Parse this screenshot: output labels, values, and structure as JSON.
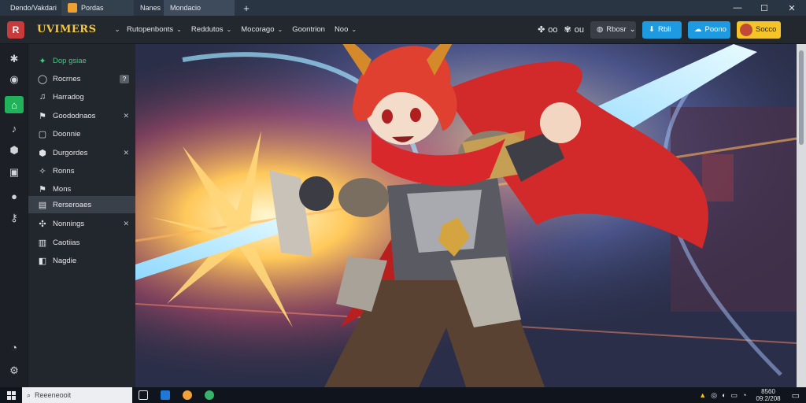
{
  "browser": {
    "tabs": [
      {
        "label": "Dendo/Vakdari",
        "color": "#27ae60"
      },
      {
        "label": "Pordas",
        "color": "#f0a030"
      },
      {
        "label": "Nanes",
        "color": ""
      },
      {
        "label": "Mondacio",
        "color": ""
      }
    ],
    "new_tab": "+",
    "window_controls": {
      "minimize": "—",
      "maximize": "☐",
      "close": "✕"
    }
  },
  "header": {
    "logo_letter": "R",
    "brand": "UVIMERS",
    "nav": [
      {
        "label": "Rutopenbonts"
      },
      {
        "label": "Reddutos"
      },
      {
        "label": "Mocorago"
      },
      {
        "label": "Goontrion"
      },
      {
        "label": "Noo"
      }
    ],
    "tools": {
      "icon1_label": "oo",
      "icon2_label": "ou",
      "gray_button": "Rbosr",
      "blue_button_1": "Rbli",
      "blue_button_2": "Poono",
      "yellow_button": "Socco"
    }
  },
  "rail": [
    {
      "icon": "gear-icon",
      "glyph": "✱"
    },
    {
      "icon": "chat-icon",
      "glyph": "◉"
    },
    {
      "icon": "home-icon",
      "glyph": "⌂",
      "active": true
    },
    {
      "icon": "music-icon",
      "glyph": "♪"
    },
    {
      "icon": "shield-icon",
      "glyph": "⬢"
    },
    {
      "icon": "layer-icon",
      "glyph": "▣"
    },
    {
      "icon": "circle-icon",
      "glyph": "●"
    },
    {
      "icon": "key-icon",
      "glyph": "⚷"
    },
    {
      "icon": "dashboard-icon",
      "glyph": "◔"
    },
    {
      "icon": "settings-icon",
      "glyph": "⚙"
    }
  ],
  "menu": [
    {
      "label": "Dop gsiae",
      "glyph": "✦",
      "green": true
    },
    {
      "label": "Rocrnes",
      "glyph": "◯",
      "badge": "?"
    },
    {
      "label": "Harradog",
      "glyph": "♫"
    },
    {
      "label": "Goododnaos",
      "glyph": "⚑",
      "tail": "✕"
    },
    {
      "label": "Doonnie",
      "glyph": "▢"
    },
    {
      "label": "Durgordes",
      "glyph": "⬢",
      "tail": "✕"
    },
    {
      "label": "Ronns",
      "glyph": "✧"
    },
    {
      "label": "Mons",
      "glyph": "⚑"
    },
    {
      "label": "Rerseroaes",
      "glyph": "▤",
      "selected": true
    },
    {
      "label": "Nonnings",
      "glyph": "✣",
      "tail": "✕"
    },
    {
      "label": "Caotiias",
      "glyph": "▥"
    },
    {
      "label": "Nagdie",
      "glyph": "◧"
    }
  ],
  "taskbar": {
    "search_placeholder": "Reeeneooit",
    "clock_time": "8560",
    "clock_date": "09:2/208"
  }
}
